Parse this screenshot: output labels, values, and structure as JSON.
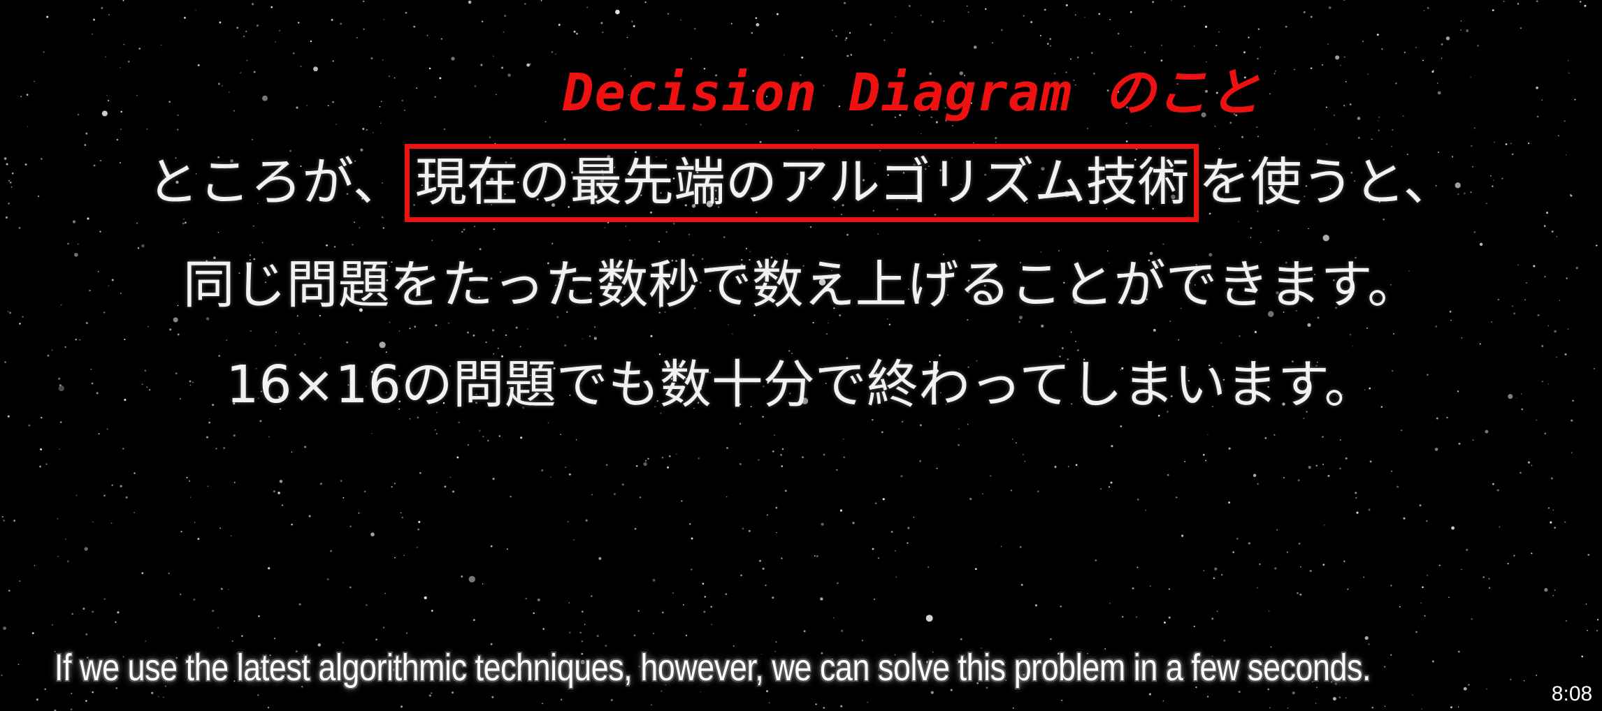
{
  "video": {
    "annotation": "Decision Diagram のこと",
    "lines": [
      {
        "before": "ところが、",
        "highlighted": "現在の最先端のアルゴリズム技術",
        "after": "を使うと、"
      },
      {
        "text": "同じ問題をたった数秒で数え上げることができます。"
      },
      {
        "text": "16×16の問題でも数十分で終わってしまいます。"
      }
    ],
    "subtitle": "If we use the latest algorithmic techniques, however, we can solve this problem in a few seconds.",
    "timestamp": "8:08"
  },
  "colors": {
    "annotation": "#ee1111",
    "highlight_border": "#ee1111",
    "background": "#000000",
    "text": "#f2f2f2"
  }
}
